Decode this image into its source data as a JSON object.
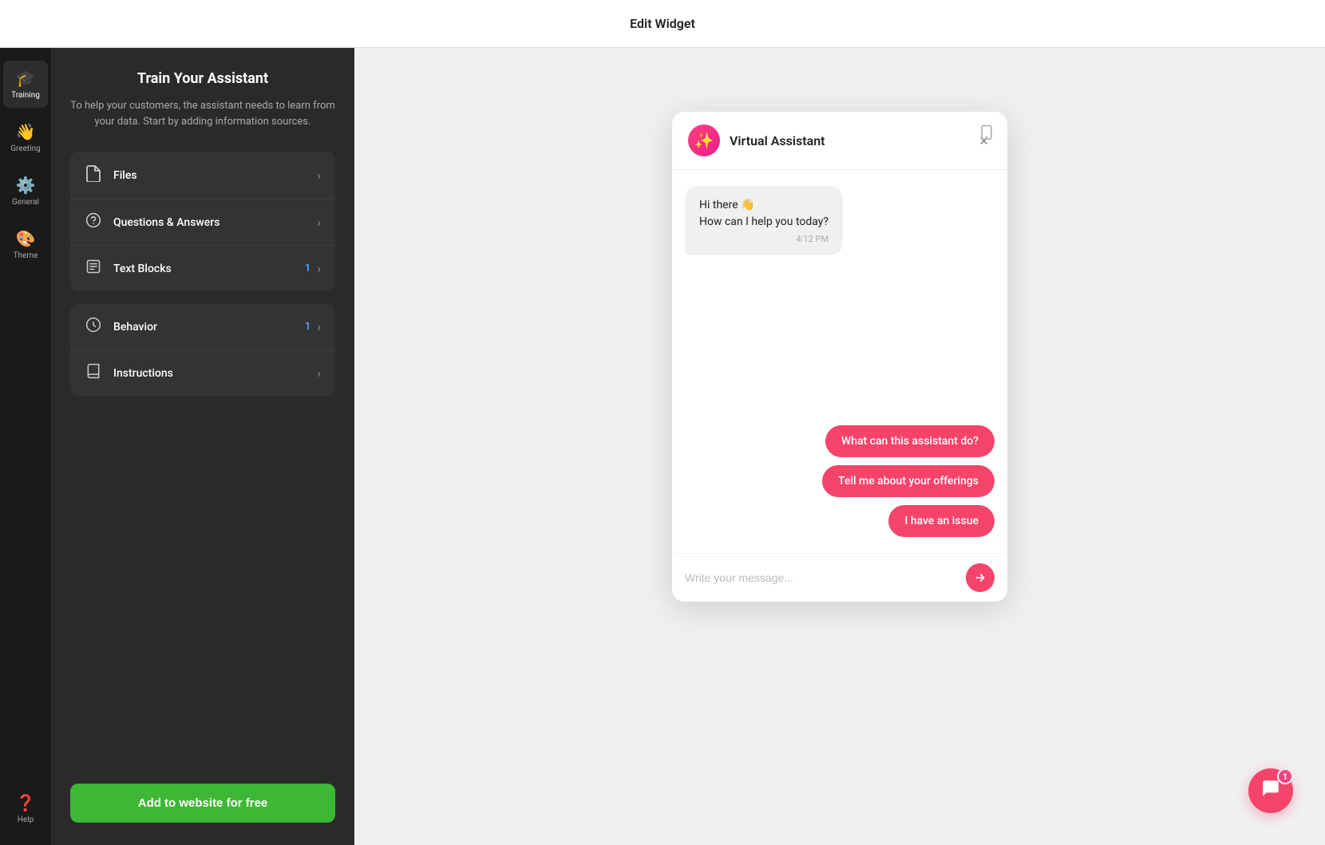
{
  "topbar": {
    "title": "Edit Widget"
  },
  "sidebar": {
    "items": [
      {
        "id": "training",
        "label": "Training",
        "icon": "🎓",
        "active": true
      },
      {
        "id": "greeting",
        "label": "Greeting",
        "icon": "👋",
        "active": false
      },
      {
        "id": "general",
        "label": "General",
        "icon": "⚙️",
        "active": false
      },
      {
        "id": "theme",
        "label": "Theme",
        "icon": "🎨",
        "active": false
      }
    ],
    "help_label": "Help"
  },
  "training": {
    "title": "Train Your Assistant",
    "description": "To help your customers, the assistant needs to learn from your data. Start by adding information sources.",
    "menu_groups": [
      {
        "items": [
          {
            "id": "files",
            "label": "Files",
            "badge": "",
            "icon": "📄"
          },
          {
            "id": "qa",
            "label": "Questions & Answers",
            "badge": "",
            "icon": "❓"
          },
          {
            "id": "text-blocks",
            "label": "Text Blocks",
            "badge": "1",
            "icon": "📝"
          }
        ]
      },
      {
        "items": [
          {
            "id": "behavior",
            "label": "Behavior",
            "badge": "1",
            "icon": "🔄"
          },
          {
            "id": "instructions",
            "label": "Instructions",
            "badge": "",
            "icon": "📖"
          }
        ]
      }
    ],
    "add_button": "Add to website for free"
  },
  "chat": {
    "header": {
      "avatar_icon": "✨",
      "title": "Virtual Assistant",
      "close_icon": "×"
    },
    "messages": [
      {
        "type": "bot",
        "text": "Hi there 👋\nHow can I help you today?",
        "time": "4:12 PM"
      }
    ],
    "suggestion_chips": [
      {
        "id": "chip1",
        "text": "What can this assistant do?"
      },
      {
        "id": "chip2",
        "text": "Tell me about your offerings"
      },
      {
        "id": "chip3",
        "text": "I have an issue"
      }
    ],
    "input_placeholder": "Write your message...",
    "send_icon": "▶"
  },
  "floating": {
    "badge": "1",
    "icon": "💬"
  }
}
